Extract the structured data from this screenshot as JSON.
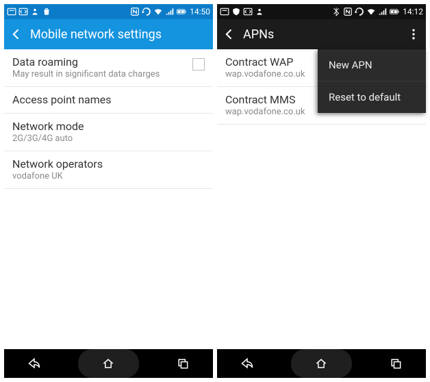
{
  "left": {
    "status": {
      "time": "14:50"
    },
    "header": {
      "title": "Mobile network settings"
    },
    "items": [
      {
        "primary": "Data roaming",
        "secondary": "May result in significant data charges",
        "checkbox": true
      },
      {
        "primary": "Access point names",
        "secondary": ""
      },
      {
        "primary": "Network mode",
        "secondary": "2G/3G/4G auto"
      },
      {
        "primary": "Network operators",
        "secondary": "vodafone UK"
      }
    ]
  },
  "right": {
    "status": {
      "time": "14:12"
    },
    "header": {
      "title": "APNs"
    },
    "items": [
      {
        "primary": "Contract WAP",
        "secondary": "wap.vodafone.co.uk"
      },
      {
        "primary": "Contract MMS",
        "secondary": "wap.vodafone.co.uk"
      }
    ],
    "popup": [
      {
        "label": "New APN"
      },
      {
        "label": "Reset to default"
      }
    ]
  }
}
